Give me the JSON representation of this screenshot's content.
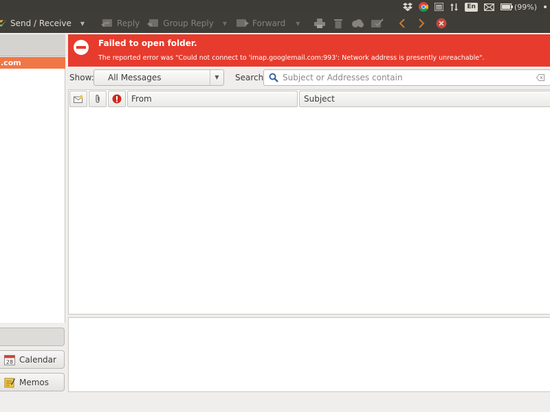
{
  "tray": {
    "language": "En",
    "battery": "(99%)"
  },
  "toolbar": {
    "send_receive": "Send / Receive",
    "reply": "Reply",
    "group_reply": "Group Reply",
    "forward": "Forward"
  },
  "sidebar": {
    "account": ".com",
    "switcher": {
      "calendar": "Calendar",
      "memos": "Memos",
      "calendar_day": "28"
    }
  },
  "error": {
    "title": "Failed to open folder.",
    "message": "The reported error was \"Could not connect to 'imap.googlemail.com:993': Network address is presently unreachable\"."
  },
  "filter": {
    "show_label": "Show:",
    "show_value": "All Messages",
    "search_label": "Search:",
    "search_placeholder": "Subject or Addresses contain"
  },
  "columns": {
    "from": "From",
    "subject": "Subject"
  },
  "colors": {
    "error_bg": "#e73b2d",
    "selection": "#f07746",
    "panel": "#3d3c37"
  }
}
